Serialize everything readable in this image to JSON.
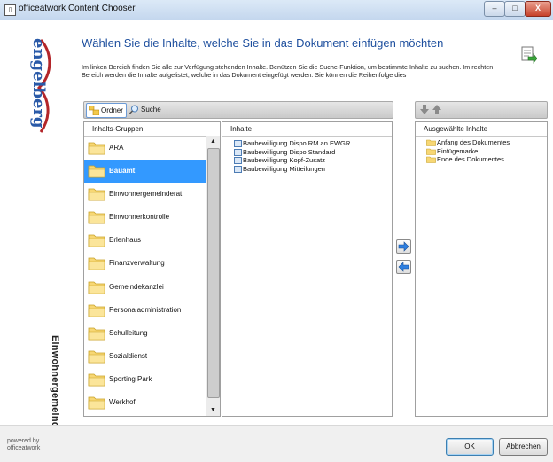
{
  "window": {
    "title": "officeatwork Content Chooser",
    "app_icon": "document-icon",
    "controls": {
      "minimize": "–",
      "maximize": "□",
      "close": "X"
    }
  },
  "sidebar": {
    "logo_text": "engelberg",
    "vertical_label": "Einwohnergemeinde"
  },
  "header": {
    "title": "Wählen Sie die Inhalte, welche Sie in das Dokument einfügen möchten",
    "description": "Im linken Bereich finden Sie alle zur Verfügung stehenden Inhalte. Benützen Sie die Suche-Funktion, um bestimmte Inhalte zu suchen. Im rechten Bereich werden die Inhalte aufgelistet, welche in das Dokument eingefügt werden. Sie können die Reihenfolge dies",
    "icon": "insert-document-icon"
  },
  "toolbar": {
    "ordner_label": "Ordner",
    "suche_label": "Suche"
  },
  "groups_panel": {
    "header": "Inhalts-Gruppen",
    "items": [
      {
        "label": "ARA",
        "selected": false
      },
      {
        "label": "Bauamt",
        "selected": true
      },
      {
        "label": "Einwohnergemeinderat",
        "selected": false
      },
      {
        "label": "Einwohnerkontrolle",
        "selected": false
      },
      {
        "label": "Erlenhaus",
        "selected": false
      },
      {
        "label": "Finanzverwaltung",
        "selected": false
      },
      {
        "label": "Gemeindekanzlei",
        "selected": false
      },
      {
        "label": "Personaladministration",
        "selected": false
      },
      {
        "label": "Schulleitung",
        "selected": false
      },
      {
        "label": "Sozialdienst",
        "selected": false
      },
      {
        "label": "Sporting Park",
        "selected": false
      },
      {
        "label": "Werkhof",
        "selected": false
      }
    ]
  },
  "contents_panel": {
    "header": "Inhalte",
    "items": [
      "Baubewilligung Dispo RM an EWGR",
      "Baubewilligung Dispo Standard",
      "Baubewilligung Kopf-Zusatz",
      "Baubewilligung Mitteilungen"
    ]
  },
  "selected_panel": {
    "header": "Ausgewählte Inhalte",
    "items": [
      "Anfang des Dokumentes",
      "Einfügemarke",
      "Ende des Dokumentes"
    ]
  },
  "footer": {
    "powered_line1": "powered by",
    "powered_line2": "officeatwork",
    "ok_label": "OK",
    "cancel_label": "Abbrechen"
  },
  "colors": {
    "heading": "#1e4f9e",
    "selection": "#3399ff",
    "logo_red": "#b3262a",
    "logo_blue": "#2a5aa8"
  }
}
